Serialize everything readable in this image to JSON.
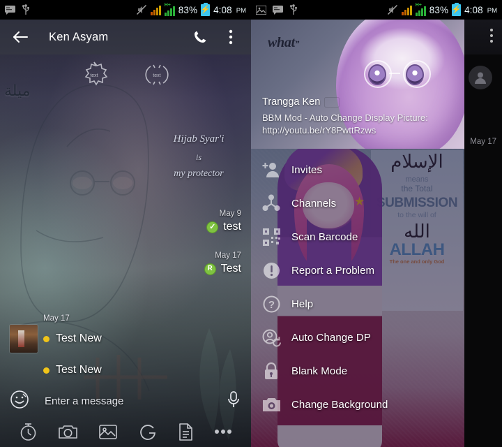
{
  "status_bar": {
    "left_icons_left_panel": [
      "message-icon",
      "usb-icon"
    ],
    "left_icons_right_panel": [
      "image-icon",
      "message-icon",
      "usb-icon"
    ],
    "mute_icon": "mute-icon",
    "signal_label": "H+",
    "battery_percent": "83%",
    "time": "4:08",
    "ampm": "PM"
  },
  "chat": {
    "appbar": {
      "back_icon": "back-arrow-icon",
      "title": "Ken Asyam",
      "call_icon": "phone-icon",
      "overflow_icon": "overflow-menu-icon"
    },
    "wallpaper": {
      "arabic_text": "ميلة",
      "quote_line1": "Hijab Syar'i",
      "quote_line2": "is",
      "quote_line3": "my protector",
      "effect_icon_1": "text-sparkle-icon",
      "effect_icon_2": "text-radiate-icon"
    },
    "messages": [
      {
        "align": "right",
        "date": "May 9",
        "status": "check",
        "status_label": "✓",
        "text": "test"
      },
      {
        "align": "right",
        "date": "May 17",
        "status": "retry",
        "status_label": "R",
        "text": "Test"
      },
      {
        "align": "left",
        "date": "May 17",
        "text": "Test New"
      },
      {
        "align": "left",
        "date": "",
        "text": "Test New"
      }
    ],
    "input": {
      "smiley_icon": "smiley-icon",
      "placeholder": "Enter a message",
      "mic_icon": "microphone-icon"
    },
    "toolbar": [
      {
        "icon": "timer-icon",
        "label": "Timer"
      },
      {
        "icon": "camera-icon",
        "label": "Camera"
      },
      {
        "icon": "gallery-icon",
        "label": "Gallery"
      },
      {
        "icon": "glympse-icon",
        "label": "Glympse"
      },
      {
        "icon": "document-icon",
        "label": "Document"
      },
      {
        "icon": "more-icon",
        "label": "More"
      }
    ]
  },
  "drawer": {
    "header": {
      "overlay_text": "what",
      "overlay_quote_mark": "”",
      "display_name": "Trangga Ken",
      "flag": "indonesia-flag",
      "status_message": "BBM Mod - Auto Change Display Picture: http://youtu.be/rY8PwttRzws"
    },
    "background_art": {
      "arabic_islam": "الإسلام",
      "line_means": "means",
      "line_total": "the Total",
      "line_submission": "SUBMISSION",
      "line_will": "to the will of",
      "arabic_allah": "الله",
      "line_allah": "ALLAH",
      "line_only_god": "The one and only God"
    },
    "menu_items": [
      {
        "icon": "add-person-icon",
        "label": "Invites"
      },
      {
        "icon": "channels-icon",
        "label": "Channels"
      },
      {
        "icon": "qr-code-icon",
        "label": "Scan Barcode"
      },
      {
        "icon": "alert-icon",
        "label": "Report a Problem"
      },
      {
        "icon": "help-icon",
        "label": "Help"
      },
      {
        "icon": "auto-change-dp-icon",
        "label": "Auto Change DP"
      },
      {
        "icon": "lock-icon",
        "label": "Blank Mode"
      },
      {
        "icon": "camera-icon",
        "label": "Change Background"
      }
    ]
  },
  "behind_panel": {
    "phone_icon": "phone-icon",
    "overflow_icon": "overflow-menu-icon",
    "avatar_icon": "avatar-placeholder-icon",
    "date": "May 17"
  },
  "colors": {
    "accent_green": "#7fc241",
    "dot_yellow": "#f0c419",
    "battery_blue": "#3cc6f0",
    "appbar": "#2f313e"
  }
}
